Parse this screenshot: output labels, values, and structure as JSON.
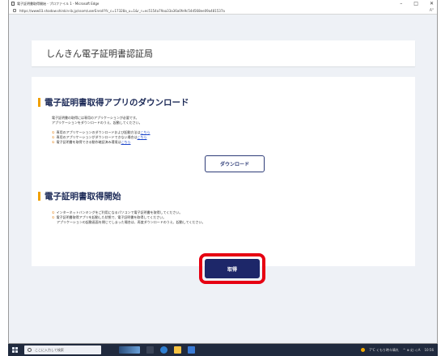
{
  "window": {
    "title": "電子証明書取得開始 - プロファイル 1 - Microsoft Edge",
    "controls": {
      "minimize": "–",
      "maximize": "□",
      "close": "✕"
    }
  },
  "address": {
    "url": "https://www03.shadow.shinkin-ib.jp/ssom/userEnroll?fc_c=17328a_u=1&r_r=ec5154a79aa33a36a0fe9c54d568ee09a481537a"
  },
  "header": {
    "site_title": "しんきん電子証明書認証局"
  },
  "download_section": {
    "title": "電子証明書取得アプリのダウンロード",
    "intro_line1": "電子証明書の取得には専用のアプリケーションが必要です。",
    "intro_line2": "アプリケーションをダウンロードのうえ、起動してください。",
    "bullets": [
      {
        "mark": "①",
        "text": "専用のアプリケーションのダウンロードおよび起動方法は",
        "link": "こちら"
      },
      {
        "mark": "①",
        "text": "専用のアプリケーションがダウンロードできない場合は",
        "link": "こちら"
      },
      {
        "mark": "①",
        "text": "電子証明書を取得できる動作確認済み環境は",
        "link": "こちら"
      }
    ],
    "download_button": "ダウンロード"
  },
  "start_section": {
    "title": "電子証明書取得開始",
    "notes": [
      {
        "mark": "①",
        "text": "インターネットバンキングをご利用になるパソコンで電子証明書を取得してください。"
      },
      {
        "mark": "①",
        "text": "電子証明書取得アプリを起動した状態で、電子証明書を取得してください。"
      }
    ],
    "note_cont": "アプリケーションの起動画面を閉じてしまった場合は、再度ダウンロードのうえ、起動してください。",
    "get_button": "取得"
  },
  "taskbar": {
    "search_placeholder": "ここに入力して検索",
    "weather": "7°C  くもり時々晴れ",
    "tray_icons": "^ ⊕ 幻 ◁ A",
    "time": "10:56"
  },
  "colors": {
    "accent_navy": "#1d2769",
    "highlight_red": "#e60012",
    "section_bar": "#f0a000",
    "link": "#1a44c9"
  }
}
